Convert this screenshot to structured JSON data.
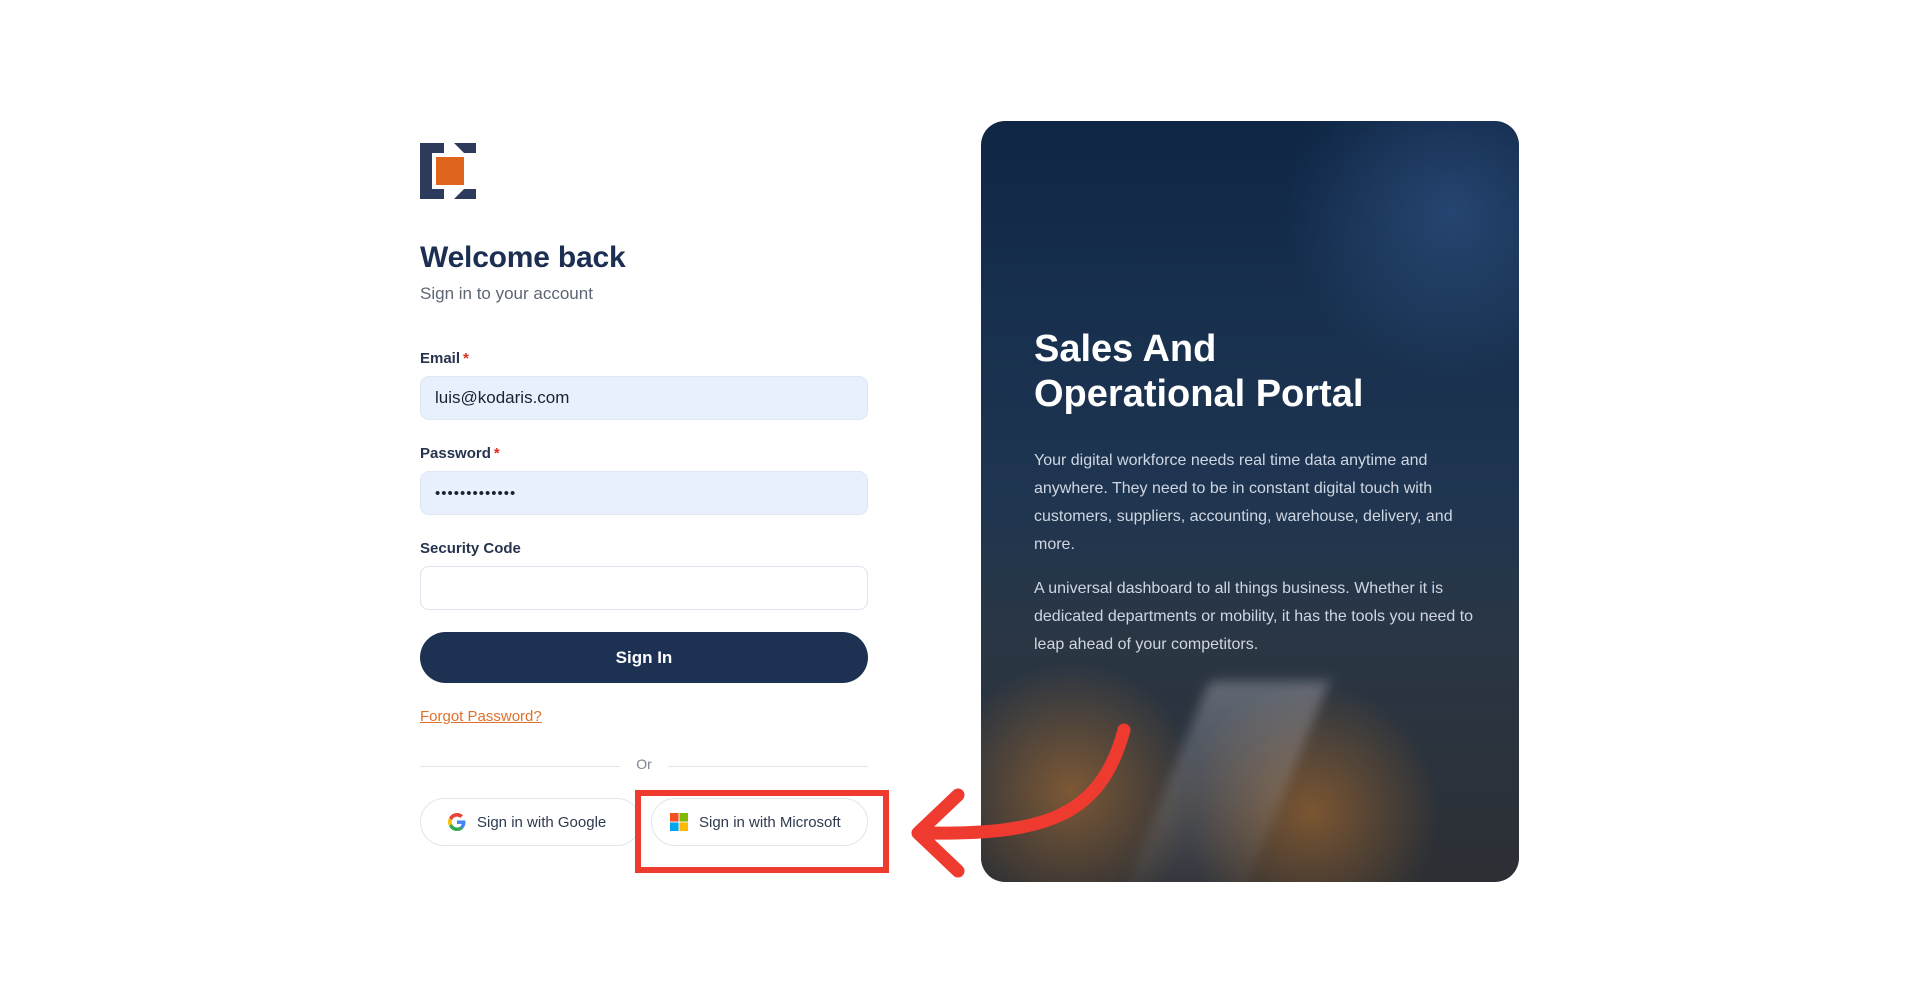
{
  "login": {
    "title": "Welcome back",
    "subtitle": "Sign in to your account",
    "email": {
      "label": "Email",
      "required_mark": "*",
      "value": "luis@kodaris.com"
    },
    "password": {
      "label": "Password",
      "required_mark": "*",
      "value": "•••••••••••••"
    },
    "security_code": {
      "label": "Security Code",
      "value": ""
    },
    "sign_in_button": "Sign In",
    "forgot_password": "Forgot Password?",
    "divider_text": "Or",
    "google_button": "Sign in with Google",
    "microsoft_button": "Sign in with Microsoft"
  },
  "promo": {
    "title_line1": "Sales And",
    "title_line2": "Operational Portal",
    "paragraph1": "Your digital workforce needs real time data anytime and anywhere. They need to be in constant digital touch with customers, suppliers, accounting, warehouse, delivery, and more.",
    "paragraph2": "A universal dashboard to all things business. Whether it is dedicated departments or mobility, it has the tools you need to leap ahead of your competitors."
  },
  "icons": {
    "logo": "kodaris-logo",
    "google": "google-icon",
    "microsoft": "microsoft-icon"
  },
  "colors": {
    "primary": "#1d3153",
    "accent": "#e1702d",
    "highlight": "#ef3b2f",
    "input_filled": "#e8effd"
  }
}
